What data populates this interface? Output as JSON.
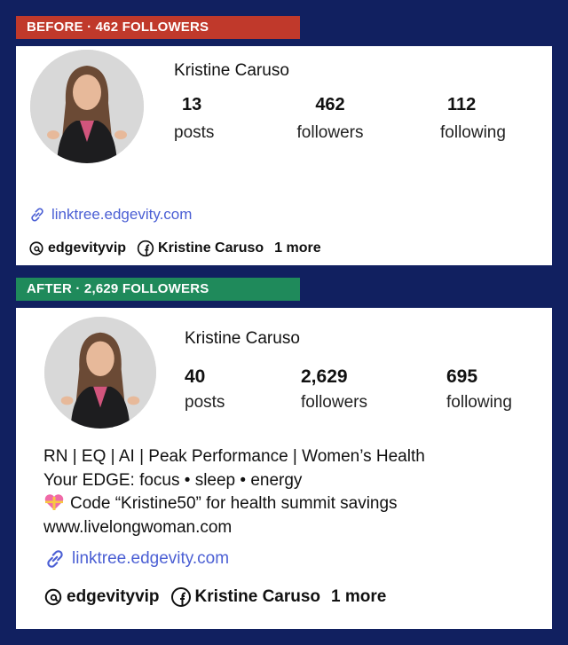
{
  "before": {
    "banner": "BEFORE · 462 FOLLOWERS",
    "name": "Kristine Caruso",
    "stats": [
      {
        "num": "13",
        "label": "posts"
      },
      {
        "num": "462",
        "label": "followers"
      },
      {
        "num": "112",
        "label": "following"
      }
    ],
    "link": "linktree.edgevity.com",
    "threads": "edgevityvip",
    "facebook": "Kristine Caruso",
    "more": "1 more"
  },
  "after": {
    "banner": "AFTER · 2,629 FOLLOWERS",
    "name": "Kristine Caruso",
    "stats": [
      {
        "num": "40",
        "label": "posts"
      },
      {
        "num": "2,629",
        "label": "followers"
      },
      {
        "num": "695",
        "label": "following"
      }
    ],
    "bio": [
      "RN | EQ | AI | Peak Performance | Women’s Health",
      "Your EDGE: focus • sleep • energy",
      "Code “Kristine50” for health summit savings",
      "www.livelongwoman.com"
    ],
    "link": "linktree.edgevity.com",
    "threads": "edgevityvip",
    "facebook": "Kristine Caruso",
    "more": "1 more"
  },
  "colors": {
    "page_bg": "#112060",
    "before_banner": "#c0392b",
    "after_banner": "#1f8a5b",
    "link": "#4b5fd4"
  },
  "icons": [
    "link-icon",
    "threads-icon",
    "facebook-icon",
    "heart-gift-emoji-icon"
  ]
}
